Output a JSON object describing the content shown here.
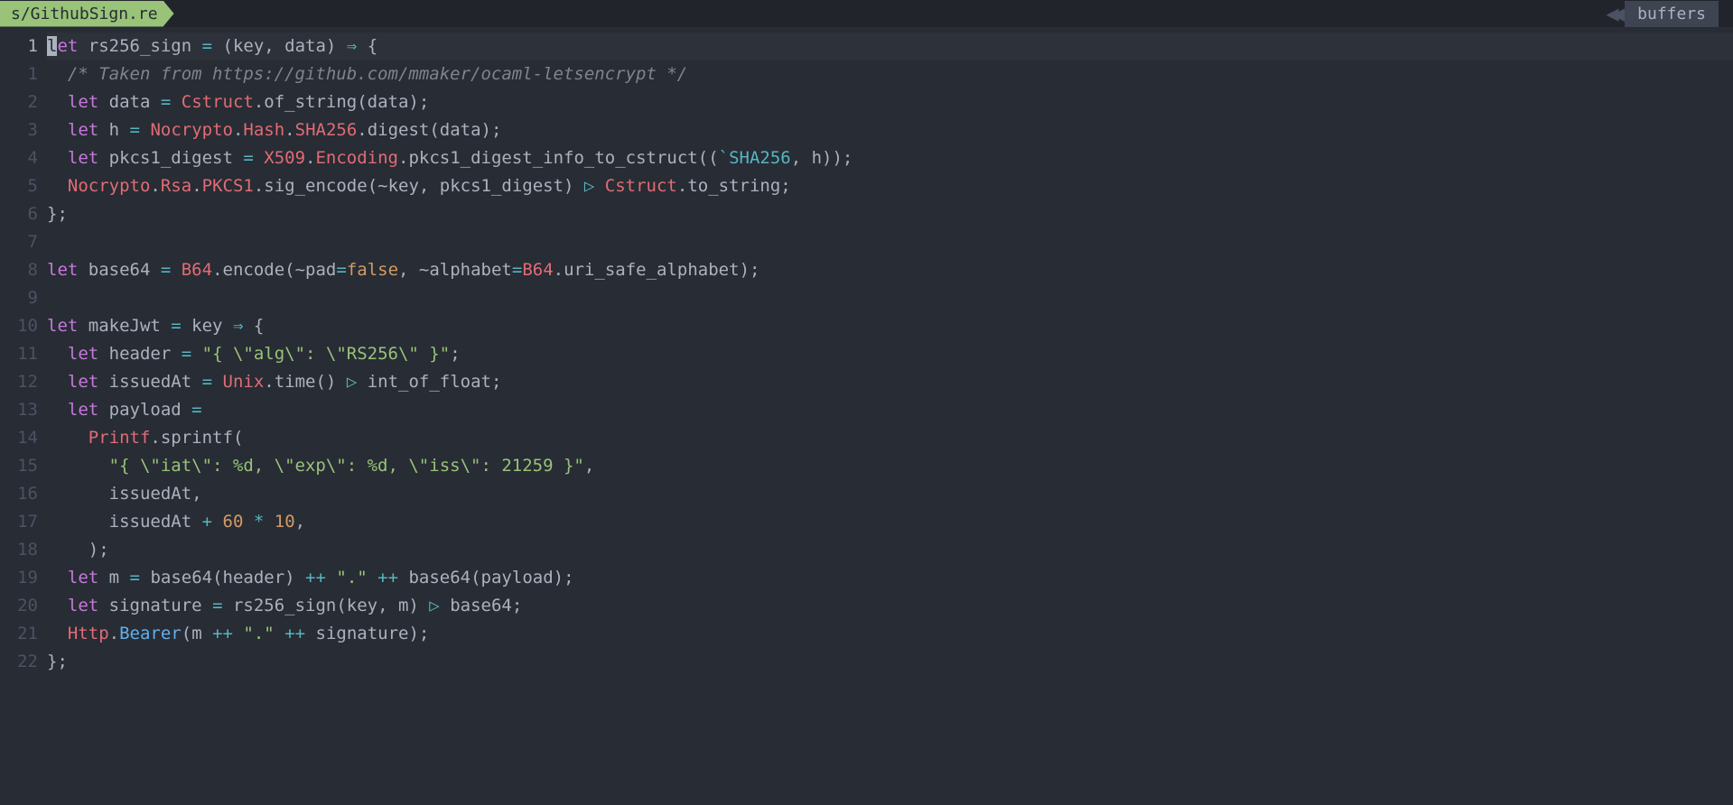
{
  "tab": {
    "filename": "s/GithubSign.re"
  },
  "buffers_label": "buffers",
  "gutter": [
    "1",
    "1",
    "2",
    "3",
    "4",
    "5",
    "6",
    "7",
    "8",
    "9",
    "10",
    "11",
    "12",
    "13",
    "14",
    "15",
    "16",
    "17",
    "18",
    "19",
    "20",
    "21",
    "22"
  ],
  "code": {
    "l0": {
      "kw": "let",
      "name": " rs256_sign ",
      "eq": "=",
      "args": " (key, data) ",
      "arrow": "⇒",
      "brace": " {"
    },
    "l1": {
      "indent": "  ",
      "comment": "/* Taken from https://github.com/mmaker/ocaml-letsencrypt */"
    },
    "l2": {
      "indent": "  ",
      "kw": "let",
      "name": " data ",
      "eq": "=",
      "ns": " Cstruct",
      "dot": ".",
      "fn": "of_string",
      "args": "(data);"
    },
    "l3": {
      "indent": "  ",
      "kw": "let",
      "name": " h ",
      "eq": "=",
      "ns1": " Nocrypto",
      "dot1": ".",
      "ns2": "Hash",
      "dot2": ".",
      "ns3": "SHA256",
      "dot3": ".",
      "fn": "digest",
      "args": "(data);"
    },
    "l4": {
      "indent": "  ",
      "kw": "let",
      "name": " pkcs1_digest ",
      "eq": "=",
      "ns1": " X509",
      "dot1": ".",
      "ns2": "Encoding",
      "dot2": ".",
      "fn": "pkcs1_digest_info_to_cstruct",
      "open": "((",
      "variant": "`SHA256",
      "rest": ", h));"
    },
    "l5": {
      "indent": "  ",
      "ns1": "Nocrypto",
      "dot1": ".",
      "ns2": "Rsa",
      "dot2": ".",
      "ns3": "PKCS1",
      "dot3": ".",
      "fn": "sig_encode",
      "args": "(~key, pkcs1_digest) ",
      "pipe": "▷",
      "ns4": " Cstruct",
      "dot4": ".",
      "fn2": "to_string;"
    },
    "l6": "};",
    "l8": {
      "kw": "let",
      "name": " base64 ",
      "eq": "=",
      "ns": " B64",
      "dot": ".",
      "fn": "encode",
      "open": "(~pad",
      "eq2": "=",
      "false": "false",
      "mid": ", ~alphabet",
      "eq3": "=",
      "ns2": "B64",
      "dot2": ".",
      "prop": "uri_safe_alphabet",
      "close": ");"
    },
    "l10": {
      "kw": "let",
      "name": " makeJwt ",
      "eq": "=",
      "arg": " key ",
      "arrow": "⇒",
      "brace": " {"
    },
    "l11": {
      "indent": "  ",
      "kw": "let",
      "name": " header ",
      "eq": "=",
      "sp": " ",
      "str": "\"{ \\\"alg\\\": \\\"RS256\\\" }\"",
      "semi": ";"
    },
    "l12": {
      "indent": "  ",
      "kw": "let",
      "name": " issuedAt ",
      "eq": "=",
      "ns": " Unix",
      "dot": ".",
      "fn": "time",
      "args": "() ",
      "pipe": "▷",
      "rest": " int_of_float;"
    },
    "l13": {
      "indent": "  ",
      "kw": "let",
      "name": " payload ",
      "eq": "="
    },
    "l14": {
      "indent": "    ",
      "ns": "Printf",
      "dot": ".",
      "fn": "sprintf",
      "open": "("
    },
    "l15": {
      "indent": "      ",
      "str": "\"{ \\\"iat\\\": %d, \\\"exp\\\": %d, \\\"iss\\\": 21259 }\"",
      "comma": ","
    },
    "l16": {
      "indent": "      ",
      "text": "issuedAt,"
    },
    "l17": {
      "indent": "      ",
      "text1": "issuedAt ",
      "op1": "+",
      "sp1": " ",
      "n1": "60",
      "sp2": " ",
      "op2": "*",
      "sp3": " ",
      "n2": "10",
      "comma": ","
    },
    "l18": {
      "indent": "    ",
      "close": ");"
    },
    "l19": {
      "indent": "  ",
      "kw": "let",
      "name": " m ",
      "eq": "=",
      "text1": " base64(header) ",
      "op1": "++",
      "sp1": " ",
      "str1": "\".\"",
      "sp2": " ",
      "op2": "++",
      "text2": " base64(payload);"
    },
    "l20": {
      "indent": "  ",
      "kw": "let",
      "name": " signature ",
      "eq": "=",
      "text1": " rs256_sign(key, m) ",
      "pipe": "▷",
      "text2": " base64;"
    },
    "l21": {
      "indent": "  ",
      "ns": "Http",
      "dot": ".",
      "prop": "Bearer",
      "open": "(m ",
      "op1": "++",
      "sp1": " ",
      "str": "\".\"",
      "sp2": " ",
      "op2": "++",
      "text": " signature);"
    },
    "l22": "};"
  }
}
